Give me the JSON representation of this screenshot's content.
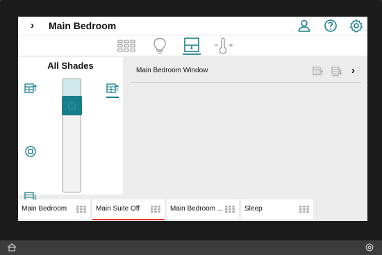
{
  "header": {
    "room_title": "Main Bedroom"
  },
  "left_panel": {
    "title": "All Shades",
    "position_percent": 30
  },
  "shades": [
    {
      "name": "Main Bedroom Window"
    }
  ],
  "scenes": [
    {
      "label": "Main Bedroom",
      "selected": false
    },
    {
      "label": "Main Suite Off",
      "selected": true
    },
    {
      "label": "Main Bedroom ...",
      "selected": false
    },
    {
      "label": "Sleep",
      "selected": false
    }
  ],
  "colors": {
    "accent": "#177e8b",
    "selected_underline": "#e53935"
  }
}
